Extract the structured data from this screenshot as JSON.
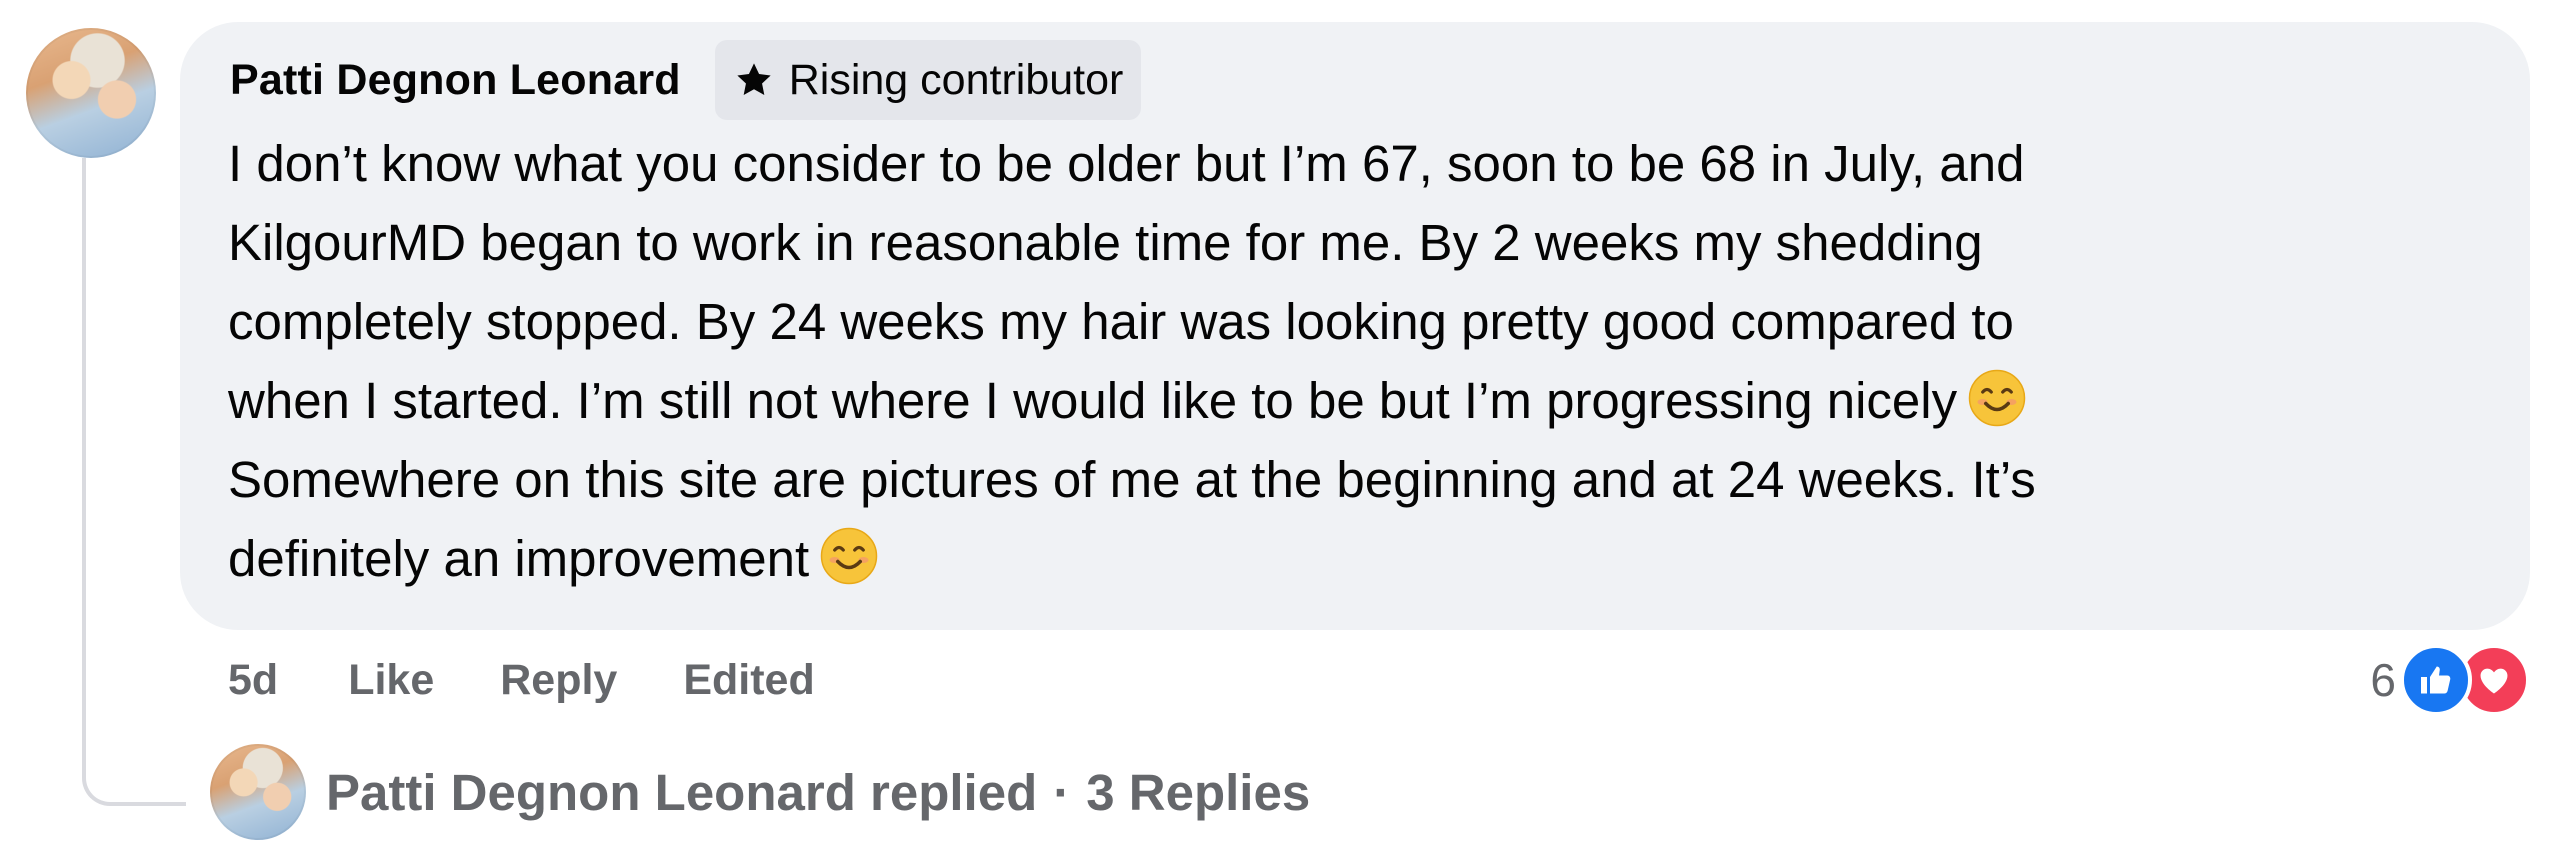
{
  "comment": {
    "author_name": "Patti Degnon Leonard",
    "badge": {
      "label": "Rising contributor",
      "icon": "star-icon"
    },
    "text_lines": [
      "I don’t know what you consider to be older but I’m 67, soon to be 68 in July, and",
      "KilgourMD began to work in reasonable time for me. By 2 weeks my shedding",
      "completely stopped. By 24 weeks my hair was looking pretty good compared to",
      "when I started. I’m still not where I would like to be but I’m progressing nicely",
      "Somewhere on this site are pictures of me at the beginning and at 24 weeks. It’s",
      "definitely an improvement"
    ],
    "emoji": "smiling-face-emoji"
  },
  "actions": {
    "time": "5d",
    "like_label": "Like",
    "reply_label": "Reply",
    "edited_label": "Edited"
  },
  "reactions": {
    "count": "6",
    "types": [
      "like-icon",
      "love-icon"
    ],
    "colors": {
      "like": "#1877f2",
      "love": "#f33e58"
    }
  },
  "replies": {
    "text": "Patti Degnon Leonard replied",
    "separator": "·",
    "count_label": "3 Replies"
  },
  "colors": {
    "bubble_bg": "#f0f2f5",
    "secondary_text": "#65676b",
    "primary_text": "#050505",
    "badge_bg": "#e4e6eb"
  }
}
